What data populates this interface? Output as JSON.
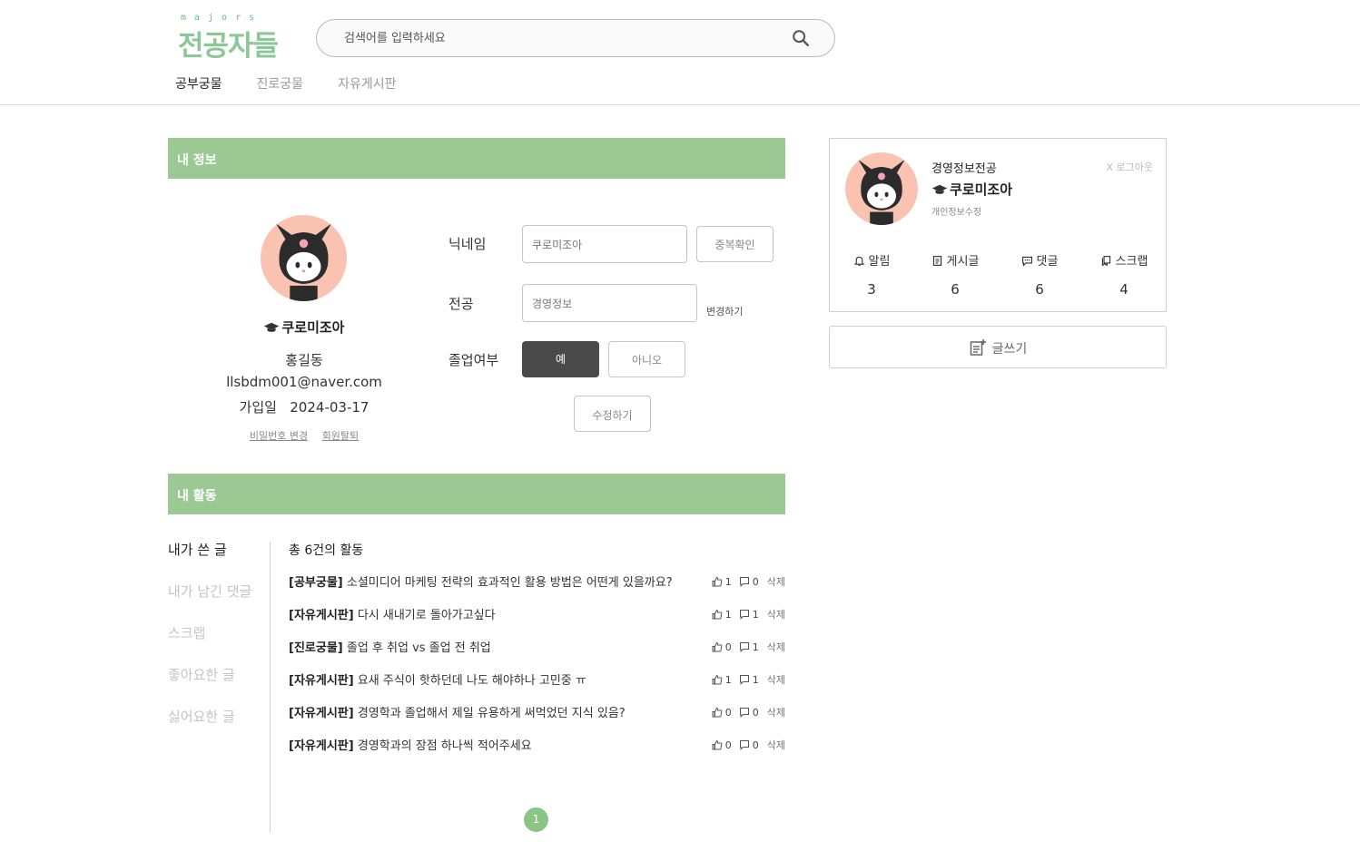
{
  "header": {
    "logo_sub": "majors",
    "logo_main": "전공자들",
    "search_placeholder": "검색어를 입력하세요",
    "nav": [
      {
        "label": "공부궁물"
      },
      {
        "label": "진로궁물"
      },
      {
        "label": "자유게시판"
      }
    ]
  },
  "my_info": {
    "section_title": "내 정보",
    "nickname": "쿠로미조아",
    "name": "홍길동",
    "email": "llsbdm001@naver.com",
    "join_label": "가입일",
    "join_date": "2024-03-17",
    "change_password": "비밀번호 변경",
    "withdraw": "회원탈퇴"
  },
  "form": {
    "nickname_label": "닉네임",
    "nickname_value": "쿠로미조아",
    "check_duplicate": "중복확인",
    "major_label": "전공",
    "major_value": "경영정보",
    "change_major": "변경하기",
    "graduated_label": "졸업여부",
    "yes": "예",
    "no": "아니오",
    "submit": "수정하기"
  },
  "side_card": {
    "major": "경영정보전공",
    "nickname": "쿠로미조아",
    "edit_profile": "개인정보수정",
    "logout": "X 로그아웃",
    "stats": [
      {
        "label": "알림",
        "count": "3",
        "icon": "bell-icon"
      },
      {
        "label": "게시글",
        "count": "6",
        "icon": "document-icon"
      },
      {
        "label": "댓글",
        "count": "6",
        "icon": "comment-icon"
      },
      {
        "label": "스크랩",
        "count": "4",
        "icon": "scrap-icon"
      }
    ],
    "write_label": "글쓰기"
  },
  "activity": {
    "section_title": "내 활동",
    "menu": [
      {
        "label": "내가 쓴 글"
      },
      {
        "label": "내가 남긴 댓글"
      },
      {
        "label": "스크랩"
      },
      {
        "label": "좋아요한 글"
      },
      {
        "label": "싫어요한 글"
      }
    ],
    "total": "총 6건의 활동",
    "delete_label": "삭제",
    "posts": [
      {
        "board": "[공부궁물]",
        "title": "소셜미디어 마케팅 전략의 효과적인 활용 방법은 어떤게 있을까요?",
        "likes": "1",
        "comments": "0"
      },
      {
        "board": "[자유게시판]",
        "title": "다시 새내기로 돌아가고싶다",
        "likes": "1",
        "comments": "1"
      },
      {
        "board": "[진로궁물]",
        "title": "졸업 후 취업 vs 졸업 전 취업",
        "likes": "0",
        "comments": "1"
      },
      {
        "board": "[자유게시판]",
        "title": "요새 주식이 핫하던데 나도 해야하나 고민중 ㅠ",
        "likes": "1",
        "comments": "1"
      },
      {
        "board": "[자유게시판]",
        "title": "경영학과 졸업해서 제일 유용하게 써먹었던 지식 있음?",
        "likes": "0",
        "comments": "0"
      },
      {
        "board": "[자유게시판]",
        "title": "경영학과의 장점 하나씩 적어주세요",
        "likes": "0",
        "comments": "0"
      }
    ],
    "page": "1"
  },
  "colors": {
    "accent_green": "#9bc893",
    "logo_green": "#8cc896",
    "pager_green": "#8cc485",
    "avatar_bg": "#f9c2b1",
    "dark_button": "#4a4a4a"
  }
}
